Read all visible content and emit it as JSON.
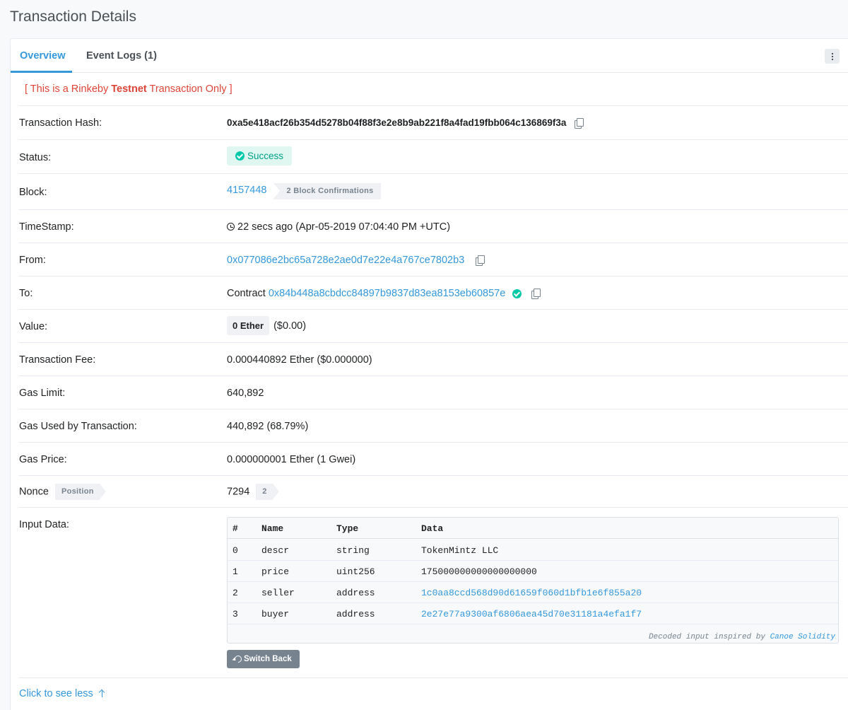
{
  "page": {
    "title": "Transaction Details"
  },
  "tabs": [
    {
      "label": "Overview",
      "active": true
    },
    {
      "label": "Event Logs (1)",
      "active": false
    }
  ],
  "notice": {
    "prefix": "[ This is a Rinkeby ",
    "emphasis": "Testnet",
    "suffix": " Transaction Only ]"
  },
  "fields": {
    "tx_hash": {
      "label": "Transaction Hash:",
      "value": "0xa5e418acf26b354d5278b04f88f3e2e8b9ab221f8a4fad19fbb064c136869f3a"
    },
    "status": {
      "label": "Status:",
      "value": "Success"
    },
    "block": {
      "label": "Block:",
      "value": "4157448",
      "confirmations": "2 Block Confirmations"
    },
    "timestamp": {
      "label": "TimeStamp:",
      "value": "22 secs ago (Apr-05-2019 07:04:40 PM +UTC)"
    },
    "from": {
      "label": "From:",
      "value": "0x077086e2bc65a728e2ae0d7e22e4a767ce7802b3"
    },
    "to": {
      "label": "To:",
      "prefix": "Contract",
      "value": "0x84b448a8cbdcc84897b9837d83ea8153eb60857e"
    },
    "value": {
      "label": "Value:",
      "amount": "0 Ether",
      "usd": "($0.00)"
    },
    "fee": {
      "label": "Transaction Fee:",
      "value": "0.000440892 Ether ($0.000000)"
    },
    "gas_limit": {
      "label": "Gas Limit:",
      "value": "640,892"
    },
    "gas_used": {
      "label": "Gas Used by Transaction:",
      "value": "440,892 (68.79%)"
    },
    "gas_price": {
      "label": "Gas Price:",
      "value": "0.000000001 Ether (1 Gwei)"
    },
    "nonce": {
      "label": "Nonce",
      "position_label": "Position",
      "value": "7294",
      "position": "2"
    },
    "input": {
      "label": "Input Data:"
    }
  },
  "input_table": {
    "headers": [
      "#",
      "Name",
      "Type",
      "Data"
    ],
    "rows": [
      {
        "idx": "0",
        "name": "descr",
        "type": "string",
        "data": "TokenMintz LLC"
      },
      {
        "idx": "1",
        "name": "price",
        "type": "uint256",
        "data": "175000000000000000000"
      },
      {
        "idx": "2",
        "name": "seller",
        "type": "address",
        "data": "1c0aa8ccd568d90d61659f060d1bfb1e6f855a20"
      },
      {
        "idx": "3",
        "name": "buyer",
        "type": "address",
        "data": "2e27e77a9300af6806aea45d70e31181a4efa1f7"
      }
    ],
    "decoded_prefix": "Decoded input inspired by ",
    "decoded_link": "Canoe Solidity"
  },
  "buttons": {
    "switch_back": "Switch Back",
    "see_less": "Click to see less"
  },
  "colors": {
    "accent": "#3498db",
    "success": "#00c9a7",
    "danger": "#de4437"
  }
}
